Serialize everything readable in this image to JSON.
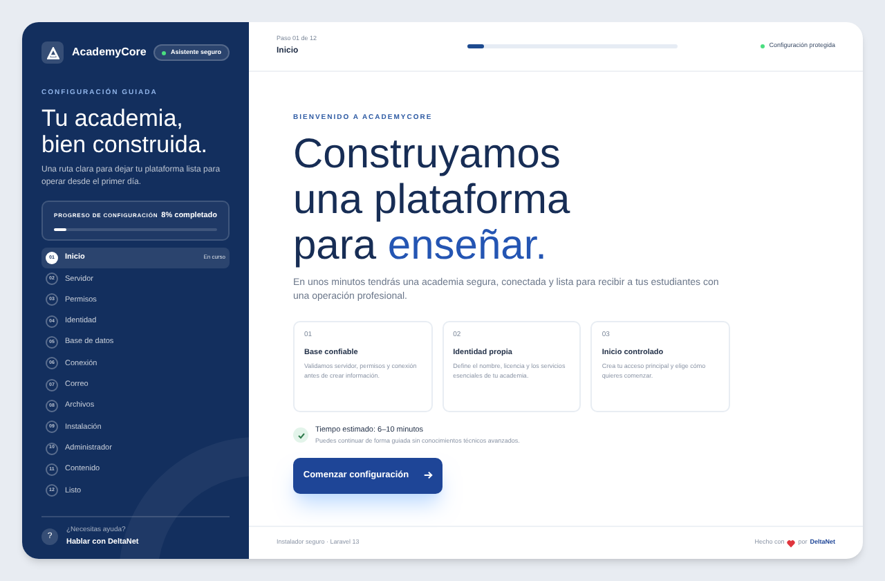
{
  "brand": {
    "name": "AcademyCore",
    "badge": "Asistente seguro"
  },
  "sidebar": {
    "eyebrow": "CONFIGURACIÓN GUIADA",
    "title_lines": [
      "Tu academia,",
      "bien construida."
    ],
    "description": "Una ruta clara para dejar tu plataforma lista para operar desde el primer día.",
    "progress": {
      "label": "PROGRESO DE CONFIGURACIÓN",
      "reading": "8% completado",
      "level": 0.08
    },
    "steps": [
      {
        "number": "01",
        "label": "Inicio",
        "selected": true,
        "status": "En curso"
      },
      {
        "number": "02",
        "label": "Servidor",
        "selected": false
      },
      {
        "number": "03",
        "label": "Permisos",
        "selected": false
      },
      {
        "number": "04",
        "label": "Identidad",
        "selected": false
      },
      {
        "number": "05",
        "label": "Base de datos",
        "selected": false
      },
      {
        "number": "06",
        "label": "Conexión",
        "selected": false
      },
      {
        "number": "07",
        "label": "Correo",
        "selected": false
      },
      {
        "number": "08",
        "label": "Archivos",
        "selected": false
      },
      {
        "number": "09",
        "label": "Instalación",
        "selected": false
      },
      {
        "number": "10",
        "label": "Administrador",
        "selected": false
      },
      {
        "number": "11",
        "label": "Contenido",
        "selected": false
      },
      {
        "number": "12",
        "label": "Listo",
        "selected": false
      }
    ],
    "help": {
      "icon": "?",
      "question": "¿Necesitas ayuda?",
      "link": "Hablar con DeltaNet"
    }
  },
  "header": {
    "step_counter": "Paso 01 de 12",
    "step_title": "Inicio",
    "level": 0.08,
    "status": "Configuración protegida"
  },
  "main": {
    "eyebrow": "BIENVENIDO A ACADEMYCORE",
    "heading_lines": [
      "Construyamos",
      "una plataforma"
    ],
    "heading_last": "para",
    "heading_accent": "enseñar.",
    "intro": "En unos minutos tendrás una academia segura, conectada y lista para recibir a tus estudiantes con una operación profesional.",
    "cards": [
      {
        "number": "01",
        "title": "Base confiable",
        "text": "Validamos servidor, permisos y conexión antes de crear información."
      },
      {
        "number": "02",
        "title": "Identidad propia",
        "text": "Define el nombre, licencia y los servicios esenciales de tu academia."
      },
      {
        "number": "03",
        "title": "Inicio controlado",
        "text": "Crea tu acceso principal y elige cómo quieres comenzar."
      }
    ],
    "estimate": {
      "title": "Tiempo estimado: 6–10 minutos",
      "text": "Puedes continuar de forma guiada sin conocimientos técnicos avanzados."
    },
    "start_button": "Comenzar configuración"
  },
  "footer": {
    "left": "Instalador seguro · Laravel 13",
    "made_with": "Hecho con",
    "by": "por",
    "company": "DeltaNet"
  }
}
